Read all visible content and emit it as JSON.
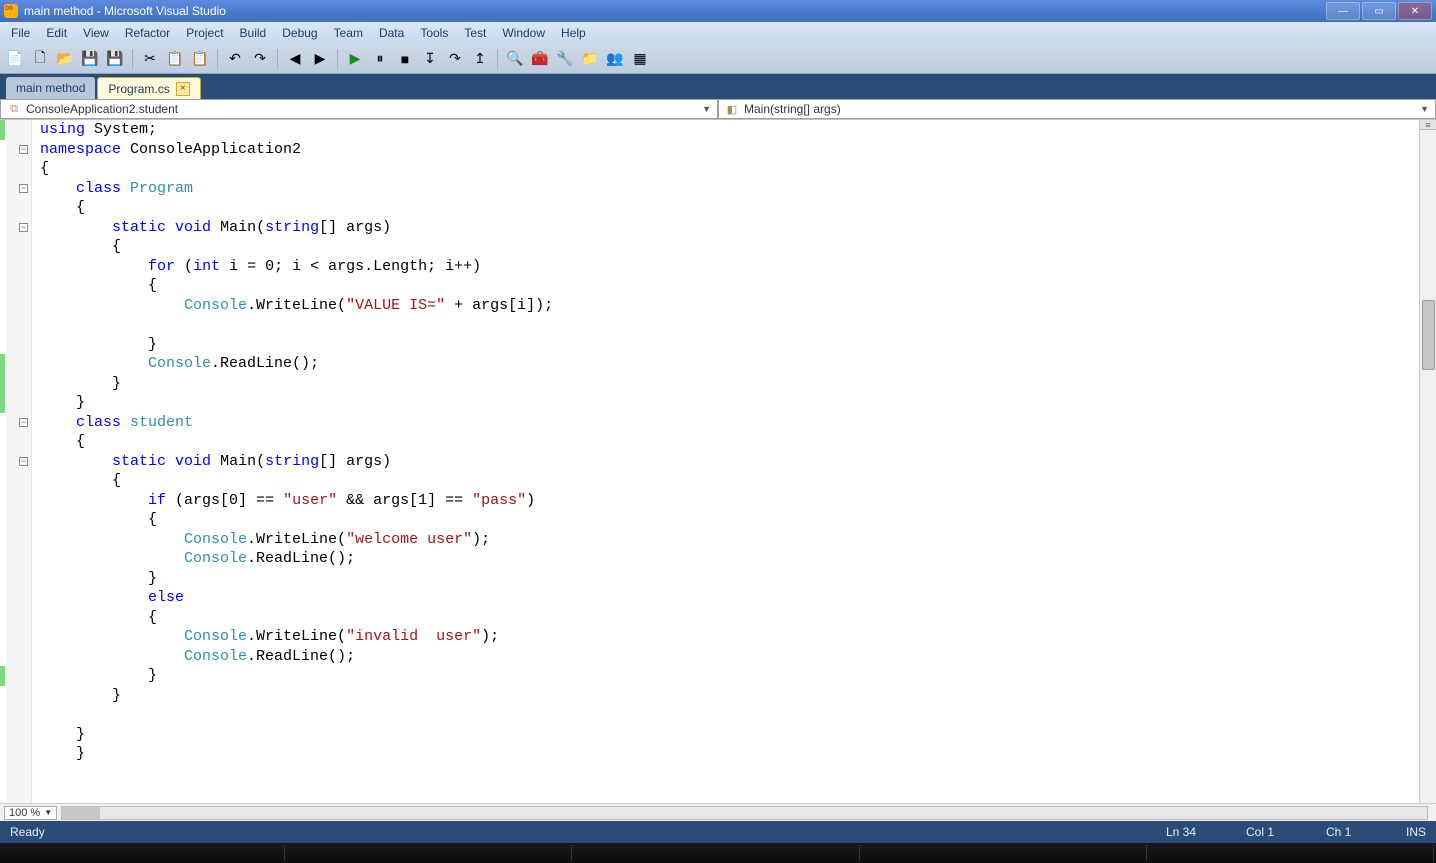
{
  "window": {
    "title": "main method - Microsoft Visual Studio"
  },
  "menu": [
    "File",
    "Edit",
    "View",
    "Refactor",
    "Project",
    "Build",
    "Debug",
    "Team",
    "Data",
    "Tools",
    "Test",
    "Window",
    "Help"
  ],
  "tabs": [
    {
      "label": "main method",
      "active": false
    },
    {
      "label": "Program.cs",
      "active": true
    }
  ],
  "nav": {
    "left": "ConsoleApplication2.student",
    "right": "Main(string[] args)"
  },
  "zoom": "100 %",
  "status": {
    "ready": "Ready",
    "ln": "Ln 34",
    "col": "Col 1",
    "ch": "Ch 1",
    "ins": "INS"
  },
  "code_lines": [
    {
      "html": "<span class=\"kw\">using</span> System;",
      "marker": "green"
    },
    {
      "html": "<span class=\"kw\">namespace</span> ConsoleApplication2",
      "fold": "-"
    },
    {
      "html": "{"
    },
    {
      "html": "    <span class=\"kw\">class</span> <span class=\"ty\">Program</span>",
      "fold": "-"
    },
    {
      "html": "    {"
    },
    {
      "html": "        <span class=\"kw\">static</span> <span class=\"kw\">void</span> Main(<span class=\"kw\">string</span>[] args)",
      "fold": "-"
    },
    {
      "html": "        {"
    },
    {
      "html": "            <span class=\"kw\">for</span> (<span class=\"kw\">int</span> i = 0; i &lt; args.Length; i++)"
    },
    {
      "html": "            {"
    },
    {
      "html": "                <span class=\"ty\">Console</span>.WriteLine(<span class=\"st\">\"VALUE IS=\"</span> + args[i]);"
    },
    {
      "html": ""
    },
    {
      "html": "            }"
    },
    {
      "html": "            <span class=\"ty\">Console</span>.ReadLine();",
      "marker": "green"
    },
    {
      "html": "        }",
      "marker": "green"
    },
    {
      "html": "    }",
      "marker": "green"
    },
    {
      "html": "    <span class=\"kw\">class</span> <span class=\"ty\">student</span>",
      "fold": "-"
    },
    {
      "html": "    {"
    },
    {
      "html": "        <span class=\"kw\">static</span> <span class=\"kw\">void</span> Main(<span class=\"kw\">string</span>[] args)",
      "fold": "-"
    },
    {
      "html": "        {"
    },
    {
      "html": "            <span class=\"kw\">if</span> (args[0] == <span class=\"st\">\"user\"</span> &amp;&amp; args[1] == <span class=\"st\">\"pass\"</span>)"
    },
    {
      "html": "            {"
    },
    {
      "html": "                <span class=\"ty\">Console</span>.WriteLine(<span class=\"st\">\"welcome user\"</span>);"
    },
    {
      "html": "                <span class=\"ty\">Console</span>.ReadLine();"
    },
    {
      "html": "            }"
    },
    {
      "html": "            <span class=\"kw\">else</span>"
    },
    {
      "html": "            {"
    },
    {
      "html": "                <span class=\"ty\">Console</span>.WriteLine(<span class=\"st\">\"invalid  user\"</span>);"
    },
    {
      "html": "                <span class=\"ty\">Console</span>.ReadLine();"
    },
    {
      "html": "            }",
      "marker": "green"
    },
    {
      "html": "        }"
    },
    {
      "html": ""
    },
    {
      "html": "    }"
    },
    {
      "html": "    }"
    }
  ]
}
